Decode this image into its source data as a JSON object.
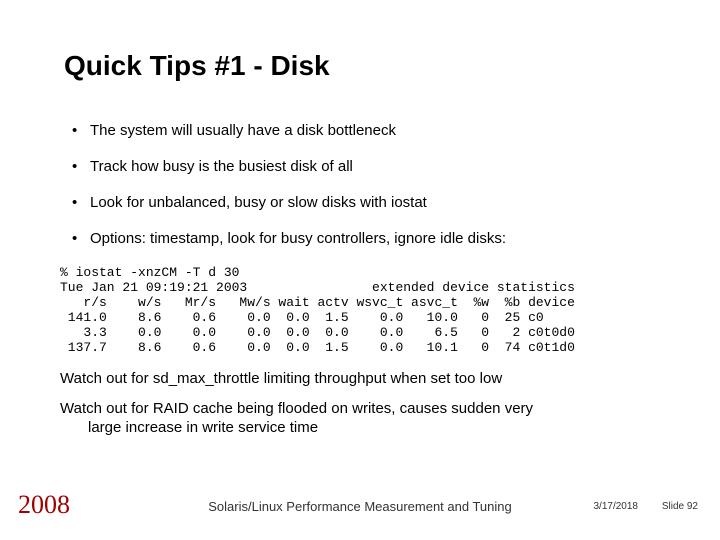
{
  "title": "Quick Tips #1 - Disk",
  "bullets": [
    "The system will usually have a disk bottleneck",
    "Track how busy is the busiest disk of all",
    "Look for unbalanced, busy or slow disks with iostat",
    "Options: timestamp, look for busy controllers, ignore idle disks:"
  ],
  "code": "% iostat -xnzCM -T d 30\nTue Jan 21 09:19:21 2003                extended device statistics\n   r/s    w/s   Mr/s   Mw/s wait actv wsvc_t asvc_t  %w  %b device\n 141.0    8.6    0.6    0.0  0.0  1.5    0.0   10.0   0  25 c0\n   3.3    0.0    0.0    0.0  0.0  0.0    0.0    6.5   0   2 c0t0d0\n 137.7    8.6    0.6    0.0  0.0  1.5    0.0   10.1   0  74 c0t1d0",
  "paras": {
    "p1": "Watch out for sd_max_throttle limiting throughput when set too low",
    "p2a": "Watch out for RAID cache being flooded on writes, causes sudden very",
    "p2b": "large increase in write service time"
  },
  "footer": {
    "year": "2008",
    "center": "Solaris/Linux Performance Measurement and Tuning",
    "date": "3/17/2018",
    "slide": "Slide 92"
  }
}
